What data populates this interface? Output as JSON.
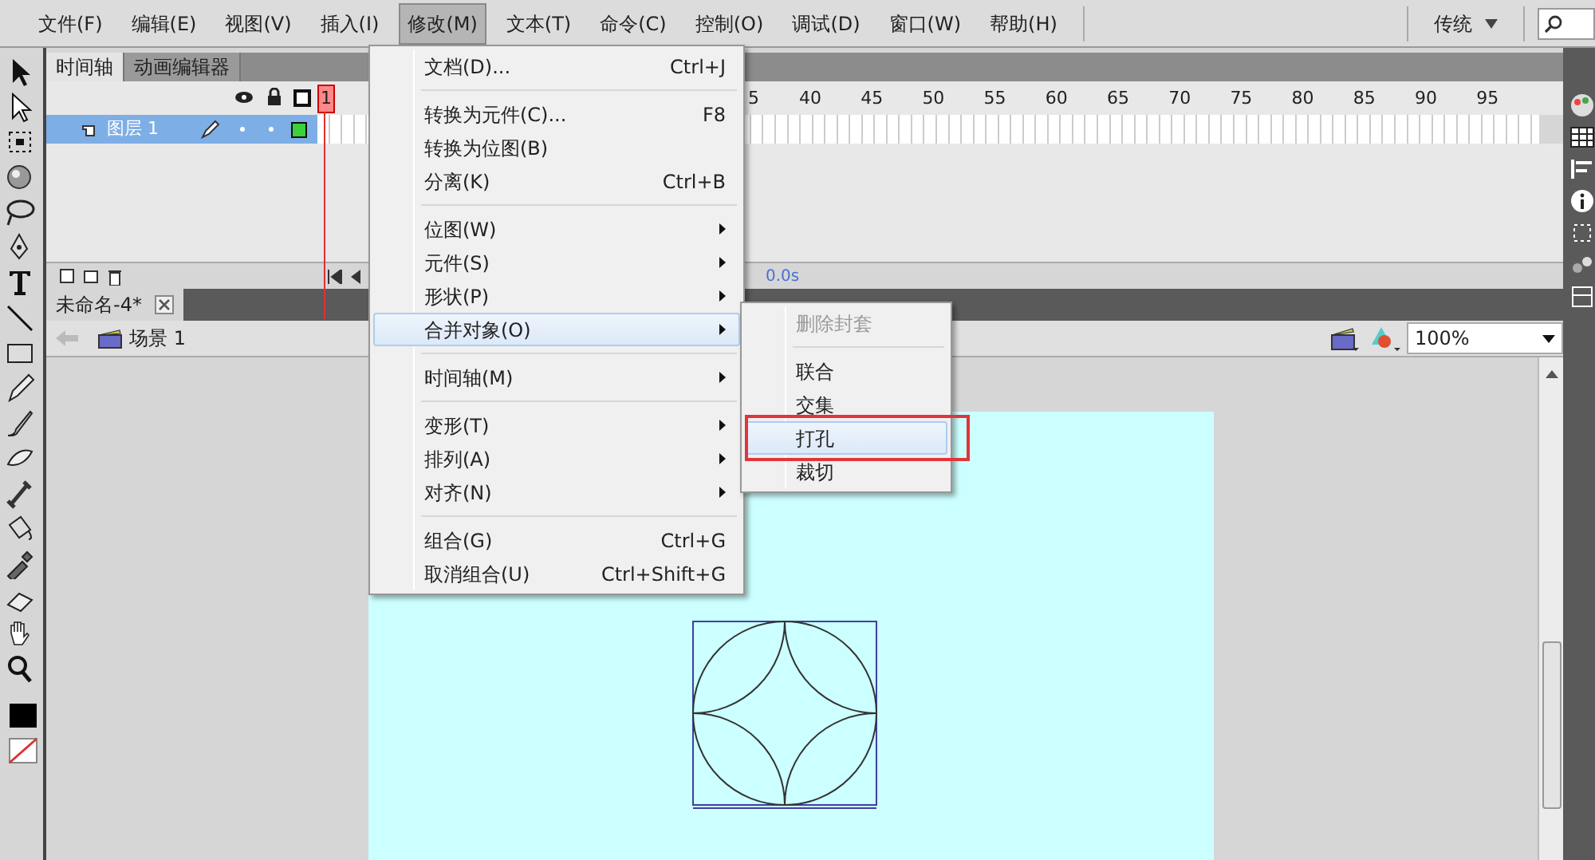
{
  "menubar": {
    "items": [
      {
        "label": "文件(F)",
        "selected": false
      },
      {
        "label": "编辑(E)",
        "selected": false
      },
      {
        "label": "视图(V)",
        "selected": false
      },
      {
        "label": "插入(I)",
        "selected": false
      },
      {
        "label": "修改(M)",
        "selected": true
      },
      {
        "label": "文本(T)",
        "selected": false
      },
      {
        "label": "命令(C)",
        "selected": false
      },
      {
        "label": "控制(O)",
        "selected": false
      },
      {
        "label": "调试(D)",
        "selected": false
      },
      {
        "label": "窗口(W)",
        "selected": false
      },
      {
        "label": "帮助(H)",
        "selected": false
      }
    ],
    "workspace": "传统"
  },
  "timeline": {
    "tabs": [
      {
        "label": "时间轴",
        "selected": true
      },
      {
        "label": "动画编辑器",
        "selected": false
      }
    ],
    "playhead": "1",
    "frame_labels": [
      "5",
      "40",
      "45",
      "50",
      "55",
      "60",
      "65",
      "70",
      "75",
      "80",
      "85",
      "90",
      "95"
    ],
    "layers": [
      {
        "name": "图层 1",
        "selected": true
      }
    ],
    "elapsed": "0.0s"
  },
  "document_tab": {
    "label": "未命名-4*"
  },
  "edit_bar": {
    "scene": "场景 1",
    "zoom": "100%"
  },
  "modify_menu": {
    "items": [
      {
        "kind": "item",
        "label": "文档(D)...",
        "shortcut": "Ctrl+J",
        "selected": false
      },
      {
        "kind": "separator"
      },
      {
        "kind": "item",
        "label": "转换为元件(C)...",
        "shortcut": "F8",
        "selected": false
      },
      {
        "kind": "item",
        "label": "转换为位图(B)",
        "selected": false
      },
      {
        "kind": "item",
        "label": "分离(K)",
        "shortcut": "Ctrl+B",
        "selected": false
      },
      {
        "kind": "separator"
      },
      {
        "kind": "submenu",
        "label": "位图(W)",
        "selected": false
      },
      {
        "kind": "submenu",
        "label": "元件(S)",
        "selected": false
      },
      {
        "kind": "submenu",
        "label": "形状(P)",
        "selected": false
      },
      {
        "kind": "submenu",
        "label": "合并对象(O)",
        "selected": true
      },
      {
        "kind": "separator"
      },
      {
        "kind": "submenu",
        "label": "时间轴(M)",
        "selected": false
      },
      {
        "kind": "separator"
      },
      {
        "kind": "submenu",
        "label": "变形(T)",
        "selected": false
      },
      {
        "kind": "submenu",
        "label": "排列(A)",
        "selected": false
      },
      {
        "kind": "submenu",
        "label": "对齐(N)",
        "selected": false
      },
      {
        "kind": "separator"
      },
      {
        "kind": "item",
        "label": "组合(G)",
        "shortcut": "Ctrl+G",
        "selected": false
      },
      {
        "kind": "item",
        "label": "取消组合(U)",
        "shortcut": "Ctrl+Shift+G",
        "selected": false
      }
    ]
  },
  "combine_submenu": {
    "items": [
      {
        "kind": "item",
        "label": "删除封套",
        "disabled": true,
        "selected": false
      },
      {
        "kind": "separator"
      },
      {
        "kind": "item",
        "label": "联合",
        "disabled": false,
        "selected": false
      },
      {
        "kind": "item",
        "label": "交集",
        "disabled": false,
        "selected": false
      },
      {
        "kind": "item",
        "label": "打孔",
        "disabled": false,
        "selected": true
      },
      {
        "kind": "item",
        "label": "裁切",
        "disabled": false,
        "selected": false
      }
    ]
  }
}
